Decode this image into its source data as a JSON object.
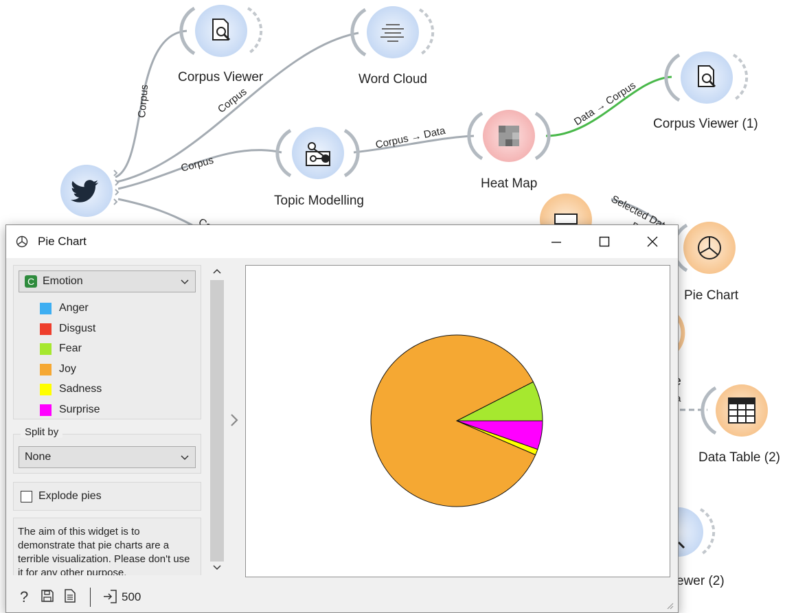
{
  "workflow": {
    "widgets": {
      "corpus_viewer": "Corpus Viewer",
      "word_cloud": "Word Cloud",
      "corpus_viewer_1": "Corpus Viewer (1)",
      "topic_modelling": "Topic Modelling",
      "heat_map": "Heat Map",
      "pie_chart": "Pie Chart",
      "data_table_2": "Data Table (2)",
      "partial_table": "le",
      "partial_viewer_2": "ewer (2)"
    },
    "links": {
      "twitter_corpus_viewer": "Corpus",
      "twitter_word_cloud": "Corpus",
      "twitter_topic_modelling": "Corpus",
      "twitter_partial": "Co",
      "topic_heat": "Corpus → Data",
      "heat_viewer": "Data → Corpus",
      "selected_data": "Selected Data",
      "selected_data_tail": "D",
      "partial_data": "ata"
    }
  },
  "window": {
    "title": "Pie Chart",
    "controls": {
      "minimize": "minimize-icon",
      "maximize": "maximize-icon",
      "close": "close-icon"
    }
  },
  "panel": {
    "variable": {
      "type_badge": "C",
      "selected": "Emotion"
    },
    "legend": [
      {
        "label": "Anger",
        "color": "#3daef2"
      },
      {
        "label": "Disgust",
        "color": "#ee3e2c"
      },
      {
        "label": "Fear",
        "color": "#a6e82f"
      },
      {
        "label": "Joy",
        "color": "#f5a833"
      },
      {
        "label": "Sadness",
        "color": "#ffff00"
      },
      {
        "label": "Surprise",
        "color": "#ff00ff"
      }
    ],
    "split_by": {
      "title": "Split by",
      "selected": "None"
    },
    "explode": {
      "label": "Explode pies",
      "checked": false
    },
    "description": "The aim of this widget is to demonstrate that pie charts are a terrible visualization. Please don't use it for any other purpose."
  },
  "chart_data": {
    "type": "pie",
    "categories": [
      "Anger",
      "Disgust",
      "Fear",
      "Joy",
      "Sadness",
      "Surprise"
    ],
    "values": [
      0,
      0,
      7.5,
      86.0,
      1.1,
      5.4
    ],
    "colors": [
      "#3daef2",
      "#ee3e2c",
      "#a6e82f",
      "#f5a833",
      "#ffff00",
      "#ff00ff"
    ],
    "title": "",
    "legend_position": "left panel"
  },
  "status": {
    "output_count": "500"
  }
}
